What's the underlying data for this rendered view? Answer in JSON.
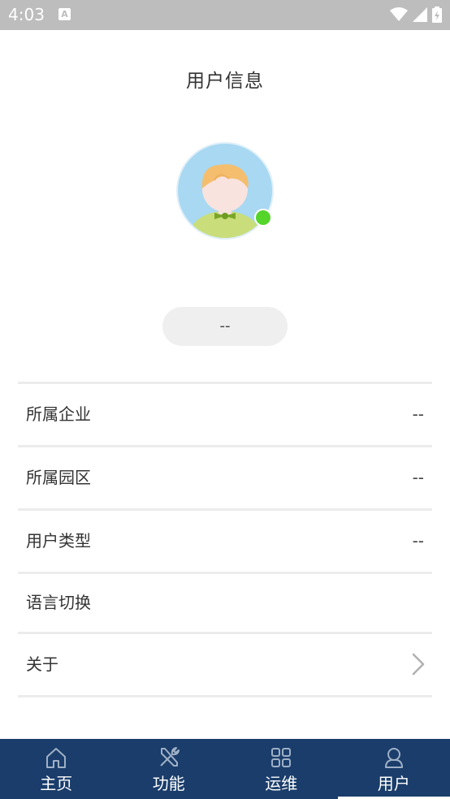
{
  "status_bar": {
    "time": "4:03",
    "notification_letter": "A"
  },
  "header": {
    "title": "用户信息"
  },
  "profile": {
    "name": "--",
    "online_color": "#55d42a"
  },
  "info_rows": [
    {
      "label": "所属企业",
      "value": "--"
    },
    {
      "label": "所属园区",
      "value": "--"
    },
    {
      "label": "用户类型",
      "value": "--"
    },
    {
      "label": "语言切换",
      "value": ""
    },
    {
      "label": "关于",
      "value": ""
    }
  ],
  "bottom_nav": {
    "background": "#1a3d6b",
    "items": [
      {
        "label": "主页",
        "icon": "home-icon"
      },
      {
        "label": "功能",
        "icon": "tools-icon"
      },
      {
        "label": "运维",
        "icon": "grid-icon"
      },
      {
        "label": "用户",
        "icon": "user-icon",
        "active": true
      }
    ]
  }
}
